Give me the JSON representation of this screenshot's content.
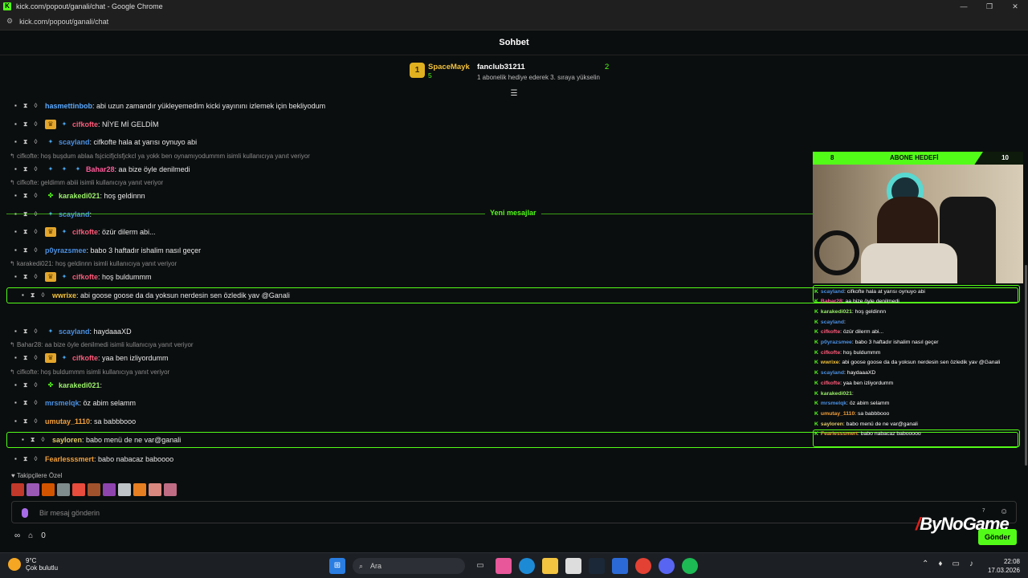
{
  "window": {
    "title": "kick.com/popout/ganali/chat - Google Chrome",
    "url": "kick.com/popout/ganali/chat",
    "controls": [
      "—",
      "❐",
      "✕"
    ]
  },
  "header": {
    "title": "Sohbet"
  },
  "leaderboard": {
    "first": {
      "rank": "1",
      "name": "SpaceMayk",
      "count": "5"
    },
    "second": {
      "name": "fanclub31211",
      "hint": "1 abonelik hediye ederek 3. sıraya yükselin",
      "count": "2"
    }
  },
  "messages": [
    {
      "user": "hasmettinbob",
      "text": ": abi uzun zamandır yükleyemedim kicki yayınını izlemek için bekliyodum",
      "color": "#5aa9ff"
    },
    {
      "user": "cifkofte",
      "text": ": NİYE Mİ GELDİM",
      "color": "#ff5a7a"
    },
    {
      "user": "scayland",
      "text": ": cifkofte hala at yarısı oynuyo abi",
      "color": "#4a90e2"
    },
    {
      "user": "Bahar28",
      "text": ": aa bize öyle denilmedi",
      "color": "#ff5a9a"
    },
    {
      "user": "karakedi021",
      "text": ": hoş geldinnn",
      "color": "#9bf06a"
    },
    {
      "user": "scayland",
      "text": ":",
      "color": "#4a90e2"
    },
    {
      "user": "cifkofte",
      "text": ": özür dilerm abi...",
      "color": "#ff5a7a"
    },
    {
      "user": "p0yrazsmee",
      "text": ": babo 3 haftadır ishalim nasıl geçer",
      "color": "#4a90e2"
    },
    {
      "user": "cifkofte",
      "text": ": hoş buldummm",
      "color": "#ff5a7a"
    },
    {
      "user": "wwrixe",
      "text": ": abi goose goose da da yoksun nerdesin sen özledik yav @Ganali",
      "color": "#f2c23b"
    },
    {
      "user": "scayland",
      "text": ": haydaaaXD",
      "color": "#4a90e2"
    },
    {
      "user": "cifkofte",
      "text": ": yaa ben izliyordumm",
      "color": "#ff5a7a"
    },
    {
      "user": "karakedi021",
      "text": ":",
      "color": "#9bf06a"
    },
    {
      "user": "mrsmelqk",
      "text": ": öz abim selamm",
      "color": "#4a90e2"
    },
    {
      "user": "umutay_1110",
      "text": ": sa babbbooo",
      "color": "#f2a03b"
    },
    {
      "user": "sayloren",
      "text": ": babo menü de ne var@ganali",
      "color": "#e2c86a"
    },
    {
      "user": "Fearlesssmert",
      "text": ": babo nabacaz baboooo",
      "color": "#f2a03b"
    }
  ],
  "replies": [
    "cifkofte: hoş buşdum ablaa fsjcicifjclsfjckcl ya yokk ben oynamıyodummm isimli kullanıcıya yanıt veriyor",
    "cifkofte: geldimm abiii isimli kullanıcıya yanıt veriyor",
    "karakedi021: hoş geldinnn isimli kullanıcıya yanıt veriyor",
    "Bahar28: aa bize öyle denilmedi isimli kullanıcıya yanıt veriyor",
    "cifkofte: hoş buldummm isimli kullanıcıya yanıt veriyor"
  ],
  "new_messages_label": "Yeni mesajlar",
  "overlay": {
    "left": "8",
    "label": "ABONE HEDEFİ",
    "right": "10"
  },
  "overlay_chat": [
    {
      "user": "scayland",
      "text": ": cifkofte hala at yarısı oynuyo abi",
      "color": "#4a90e2"
    },
    {
      "user": "Bahar28",
      "text": ": aa bize öyle denilmedi",
      "color": "#ff5a9a"
    },
    {
      "user": "karakedi021",
      "text": ": hoş geldinnn",
      "color": "#9bf06a"
    },
    {
      "user": "scayland",
      "text": ":",
      "color": "#4a90e2"
    },
    {
      "user": "cifkofte",
      "text": ": özür dilerm abi...",
      "color": "#ff5a7a"
    },
    {
      "user": "p0yrazsmee",
      "text": ": babo 3 haftadır ishalim nasıl geçer",
      "color": "#4a90e2"
    },
    {
      "user": "cifkofte",
      "text": ": hoş buldummm",
      "color": "#ff5a7a"
    },
    {
      "user": "wwrixe",
      "text": ": abi goose goose da da yoksun nerdesin sen özledik yav @Ganali",
      "color": "#f2c23b"
    },
    {
      "user": "scayland",
      "text": ": haydaaaXD",
      "color": "#4a90e2"
    },
    {
      "user": "cifkofte",
      "text": ": yaa ben izliyordumm",
      "color": "#ff5a7a"
    },
    {
      "user": "karakedi021",
      "text": ":",
      "color": "#9bf06a"
    },
    {
      "user": "mrsmelqk",
      "text": ": öz abim selamm",
      "color": "#4a90e2"
    },
    {
      "user": "umutay_1110",
      "text": ": sa babbbooo",
      "color": "#f2a03b"
    },
    {
      "user": "sayloren",
      "text": ": babo menü de ne var@ganali",
      "color": "#e2c86a"
    },
    {
      "user": "Fearlesssmert",
      "text": ": babo nabacaz babooooo",
      "color": "#f2a03b"
    }
  ],
  "followers_label": "Takipçilere Özel",
  "input": {
    "placeholder": "Bir mesaj gönderin"
  },
  "bottom": {
    "count": "0",
    "send": "Gönder"
  },
  "watermark": "ByNoGame",
  "taskbar": {
    "weather_temp": "9°C",
    "weather_desc": "Çok bulutlu",
    "search": "Ara",
    "time": "22:08",
    "date": "17.03.2026"
  }
}
